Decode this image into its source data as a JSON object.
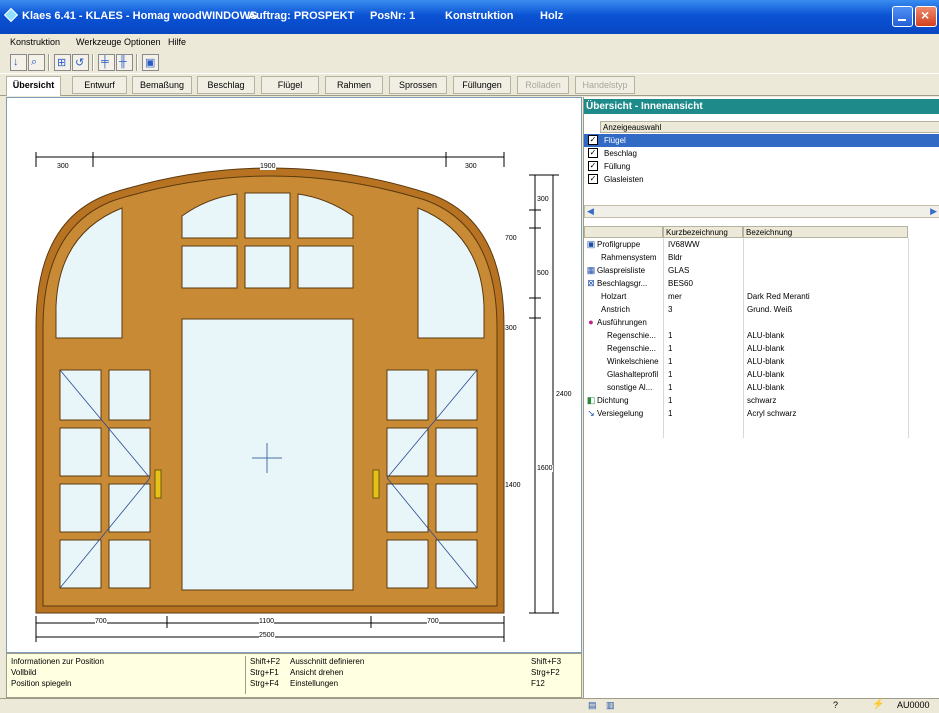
{
  "window": {
    "title_segments": [
      "Klaes 6.41 - KLAES - Homag woodWINDOWS",
      "Auftrag: PROSPEKT",
      "PosNr: 1",
      "Konstruktion",
      "Holz"
    ]
  },
  "menu": [
    "Konstruktion",
    "Werkzeuge",
    "Optionen",
    "Hilfe"
  ],
  "toolbar": {
    "icons": [
      "info-tool",
      "zoom-tool",
      "grid-tool",
      "rotate-tool",
      "frame-tool",
      "mullion-tool",
      "properties-tool"
    ]
  },
  "tabs": [
    {
      "label": "Übersicht",
      "state": "active"
    },
    {
      "label": "Entwurf",
      "state": "normal"
    },
    {
      "label": "Bemaßung",
      "state": "normal"
    },
    {
      "label": "Beschlag",
      "state": "normal"
    },
    {
      "label": "Flügel",
      "state": "normal"
    },
    {
      "label": "Rahmen",
      "state": "normal"
    },
    {
      "label": "Sprossen",
      "state": "normal"
    },
    {
      "label": "Füllungen",
      "state": "normal"
    },
    {
      "label": "Rolladen",
      "state": "disabled"
    },
    {
      "label": "Handelstyp",
      "state": "disabled"
    }
  ],
  "drawing": {
    "top_dims": [
      "300",
      "1900",
      "300"
    ],
    "bottom_dims": [
      "700",
      "1100",
      "700"
    ],
    "total_width": "2500",
    "right_dims_col1": [
      "300",
      "700",
      "500",
      "300",
      "1600",
      "1400"
    ],
    "right_dims_col2": [
      "2400"
    ],
    "colors": {
      "frame": "#b87322",
      "frame_dark": "#7a4a12",
      "glass": "#e8f6fa",
      "bg": "#ffffff"
    }
  },
  "info": {
    "rows": [
      {
        "label": "Informationen zur Position",
        "key1": "Shift+F2",
        "label2": "Ausschnitt definieren",
        "key2": "Shift+F3"
      },
      {
        "label": "Vollbild",
        "key1": "Strg+F1",
        "label2": "Ansicht drehen",
        "key2": "Strg+F2"
      },
      {
        "label": "Position spiegeln",
        "key1": "Strg+F4",
        "label2": "Einstellungen",
        "key2": "F12"
      }
    ]
  },
  "panel": {
    "title": "Übersicht - Innenansicht",
    "display_header": "Anzeigeauswahl",
    "display_items": [
      {
        "label": "Flügel",
        "checked": true,
        "selected": true
      },
      {
        "label": "Beschlag",
        "checked": true,
        "selected": false
      },
      {
        "label": "Füllung",
        "checked": true,
        "selected": false
      },
      {
        "label": "Glasleisten",
        "checked": true,
        "selected": false
      }
    ],
    "prop_headers": [
      "",
      "Kurzbezeichnung",
      "Bezeichnung"
    ],
    "props": [
      {
        "icon": "profile-icon",
        "name": "Profilgruppe",
        "short": "IV68WW",
        "desc": ""
      },
      {
        "icon": "",
        "name": "Rahmensystem",
        "short": "Bldr",
        "desc": ""
      },
      {
        "icon": "glass-icon",
        "name": "Glaspreisliste",
        "short": "GLAS",
        "desc": ""
      },
      {
        "icon": "hardware-icon",
        "name": "Beschlagsgr...",
        "short": "BES60",
        "desc": ""
      },
      {
        "icon": "",
        "name": "Holzart",
        "short": "mer",
        "desc": "Dark Red Meranti"
      },
      {
        "icon": "",
        "name": "Anstrich",
        "short": "3",
        "desc": "Grund. Weiß"
      },
      {
        "icon": "palette-icon",
        "name": "Ausführungen",
        "short": "",
        "desc": ""
      },
      {
        "icon": "",
        "name": "Regenschie...",
        "short": "1",
        "desc": "ALU-blank"
      },
      {
        "icon": "",
        "name": "Regenschie...",
        "short": "1",
        "desc": "ALU-blank"
      },
      {
        "icon": "",
        "name": "Winkelschiene",
        "short": "1",
        "desc": "ALU-blank"
      },
      {
        "icon": "",
        "name": "Glashalteprofil",
        "short": "1",
        "desc": "ALU-blank"
      },
      {
        "icon": "",
        "name": "sonstige Al...",
        "short": "1",
        "desc": "ALU-blank"
      },
      {
        "icon": "seal-icon",
        "name": "Dichtung",
        "short": "1",
        "desc": "schwarz"
      },
      {
        "icon": "sealant-icon",
        "name": "Versiegelung",
        "short": "1",
        "desc": "Acryl schwarz"
      }
    ]
  },
  "status": {
    "code": "AU0000"
  }
}
